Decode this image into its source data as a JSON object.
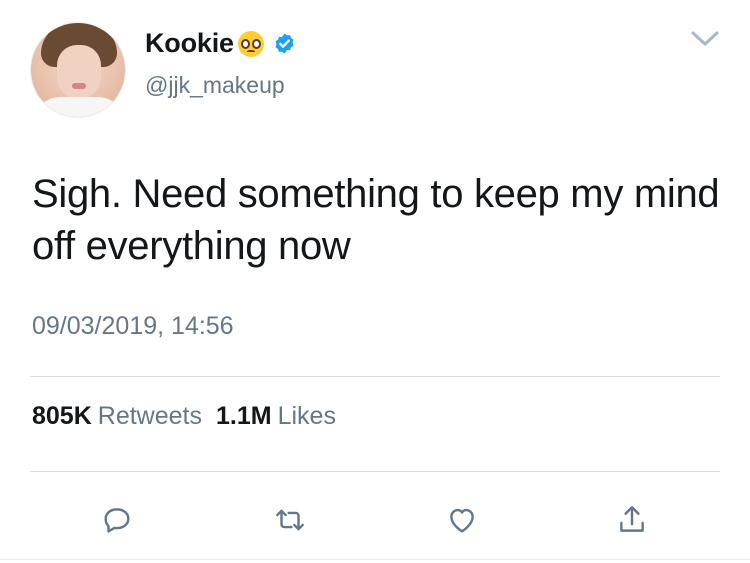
{
  "author": {
    "display_name": "Kookie",
    "handle": "@jjk_makeup",
    "emoji": "pleading-face",
    "verified": true,
    "verified_color": "#1da1f2"
  },
  "tweet": {
    "text": "Sigh. Need something to keep my mind off everything now",
    "timestamp": "09/03/2019, 14:56"
  },
  "stats": {
    "retweets_count": "805K",
    "retweets_label": "Retweets",
    "likes_count": "1.1M",
    "likes_label": "Likes"
  },
  "actions": {
    "reply_icon": "reply-icon",
    "retweet_icon": "retweet-icon",
    "like_icon": "heart-icon",
    "share_icon": "share-icon"
  },
  "colors": {
    "text": "#14171a",
    "secondary": "#657786",
    "divider": "#dcdfe2",
    "icon": "#657786"
  }
}
